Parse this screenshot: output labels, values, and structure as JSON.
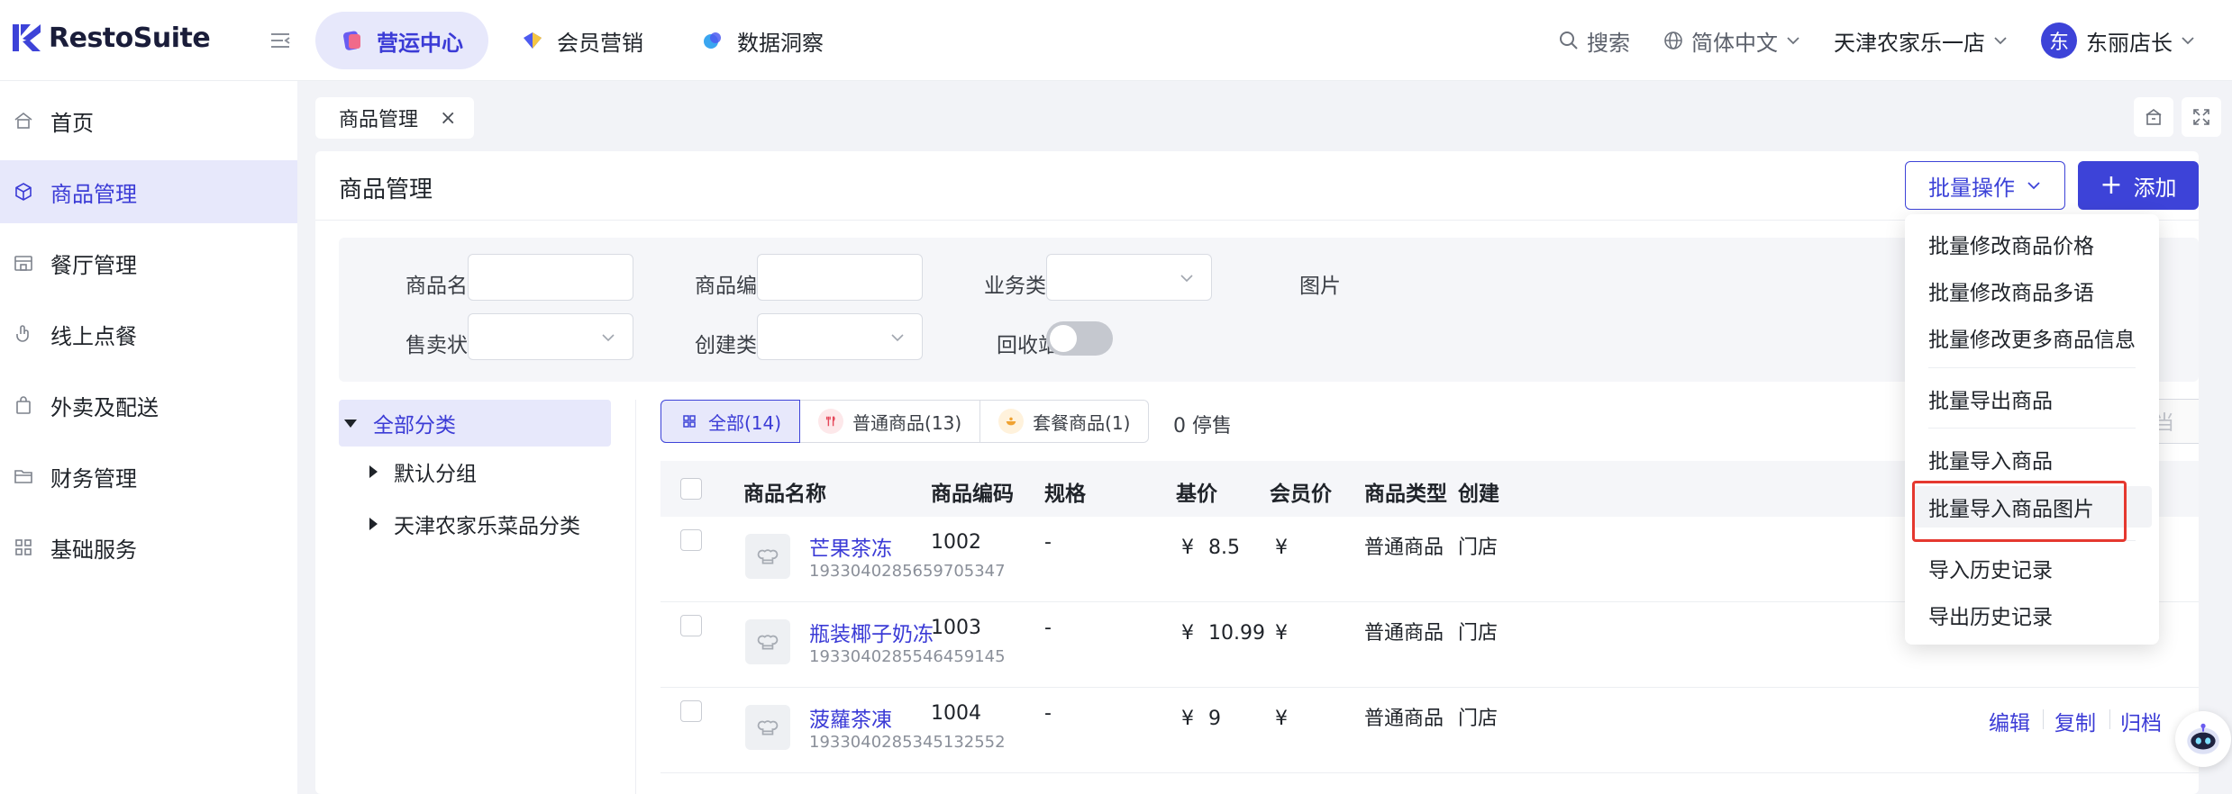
{
  "app": {
    "logo_text": "RestoSuite"
  },
  "topnav": [
    {
      "label": "营运中心",
      "icon": "ops-center-icon",
      "active": true
    },
    {
      "label": "会员营销",
      "icon": "member-marketing-icon",
      "active": false
    },
    {
      "label": "数据洞察",
      "icon": "data-insight-icon",
      "active": false
    }
  ],
  "header": {
    "search_label": "搜索",
    "language": "简体中文",
    "store": "天津农家乐一店",
    "avatar_text": "东",
    "user": "东丽店长"
  },
  "sidebar": {
    "items": [
      {
        "label": "首页",
        "icon": "home-icon",
        "active": false
      },
      {
        "label": "商品管理",
        "icon": "cube-icon",
        "active": true
      },
      {
        "label": "餐厅管理",
        "icon": "store-icon",
        "active": false
      },
      {
        "label": "线上点餐",
        "icon": "touch-icon",
        "active": false
      },
      {
        "label": "外卖及配送",
        "icon": "bag-icon",
        "active": false
      },
      {
        "label": "财务管理",
        "icon": "folder-icon",
        "active": false
      },
      {
        "label": "基础服务",
        "icon": "grid-icon",
        "active": false
      }
    ]
  },
  "page_tab": {
    "label": "商品管理",
    "close": "×"
  },
  "main": {
    "title": "商品管理",
    "batch_button": "批量操作",
    "add_button": "添加",
    "add_plus": "+"
  },
  "filters": {
    "product_name": {
      "label": "商品名称",
      "value": ""
    },
    "product_code": {
      "label": "商品编码",
      "value": ""
    },
    "business_type": {
      "label": "业务类型",
      "value": ""
    },
    "image": {
      "label": "图片"
    },
    "sale_status": {
      "label": "售卖状态",
      "value": ""
    },
    "create_type": {
      "label": "创建类型",
      "value": ""
    },
    "recycle_bin": {
      "label": "回收站",
      "on": false
    }
  },
  "tree": {
    "root": "全部分类",
    "children": [
      "默认分组",
      "天津农家乐菜品分类"
    ]
  },
  "type_tabs": [
    {
      "label": "全部(14)",
      "active": true
    },
    {
      "label": "普通商品(13)",
      "active": false
    },
    {
      "label": "套餐商品(1)",
      "active": false
    }
  ],
  "stop_count": "0 停售",
  "partial_button": "当",
  "table": {
    "headers": [
      "商品名称",
      "商品编码",
      "规格",
      "基价",
      "会员价",
      "商品类型",
      "创建"
    ],
    "currency": "¥",
    "rows": [
      {
        "name": "芒果茶冻",
        "id": "1933040285659705347",
        "code": "1002",
        "spec": "-",
        "price": "8.5",
        "member_price": "",
        "type": "普通商品",
        "origin": "门店"
      },
      {
        "name": "瓶装椰子奶冻",
        "id": "1933040285546459145",
        "code": "1003",
        "spec": "-",
        "price": "10.99",
        "member_price": "",
        "type": "普通商品",
        "origin": "门店"
      },
      {
        "name": "菠蘿茶凍",
        "id": "1933040285345132552",
        "code": "1004",
        "spec": "-",
        "price": "9",
        "member_price": "",
        "type": "普通商品",
        "origin": "门店"
      }
    ],
    "ops": [
      "编辑",
      "复制",
      "归档"
    ]
  },
  "dropdown": {
    "items": [
      "批量修改商品价格",
      "批量修改商品多语",
      "批量修改更多商品信息",
      "批量导出商品",
      "批量导入商品",
      "批量导入商品图片",
      "导入历史记录",
      "导出历史记录"
    ],
    "highlighted_index": 5
  },
  "colors": {
    "primary": "#3d43d8",
    "highlight_border": "#e5382f"
  }
}
